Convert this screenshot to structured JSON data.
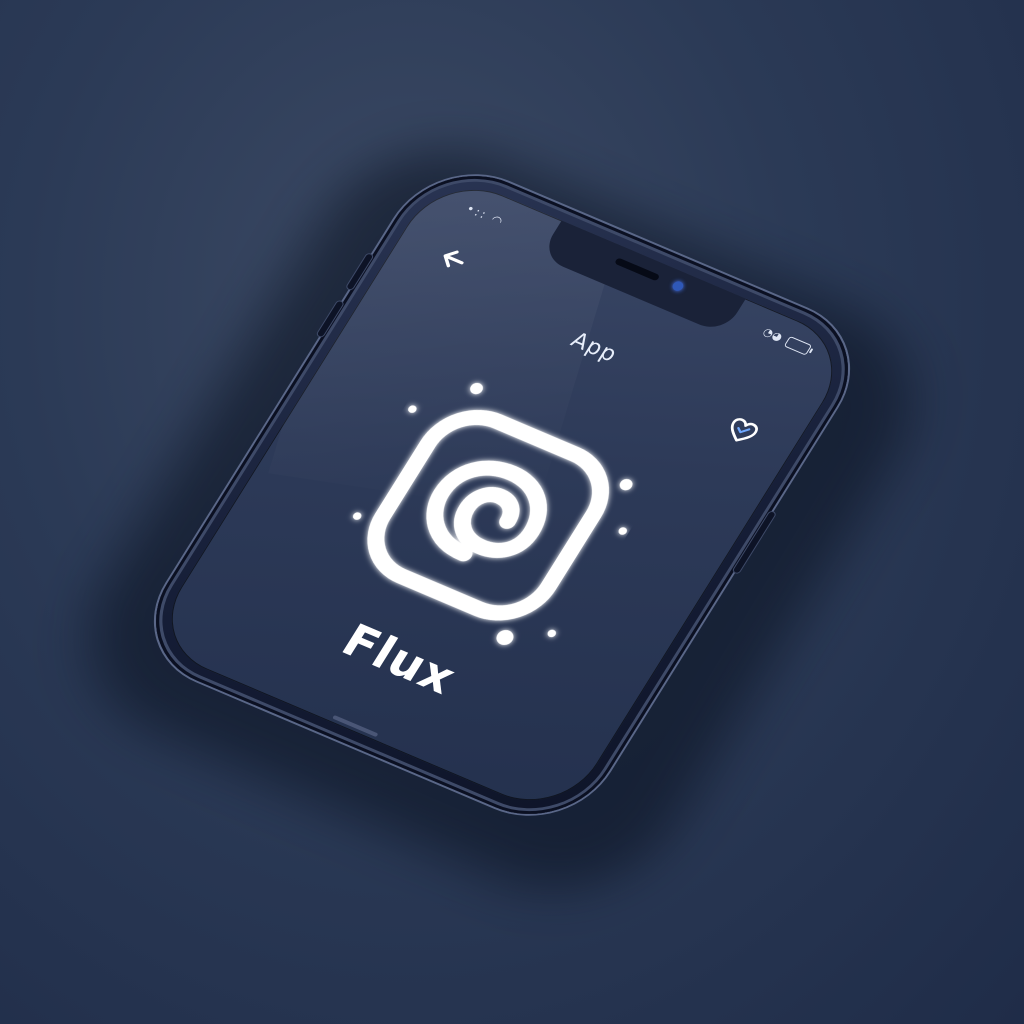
{
  "screen": {
    "title": "App",
    "brand_name": "Flux",
    "status_left": "•:: ◠",
    "status_right_glyph": "◔◕"
  },
  "icons": {
    "back": "back-arrow-icon",
    "favorite": "heart-sync-icon",
    "logo": "spiral-logo-icon"
  },
  "colors": {
    "background": "#2b3a56",
    "screen": "#2d3a58",
    "logo": "#ffffff",
    "camera": "#2f58b8"
  }
}
